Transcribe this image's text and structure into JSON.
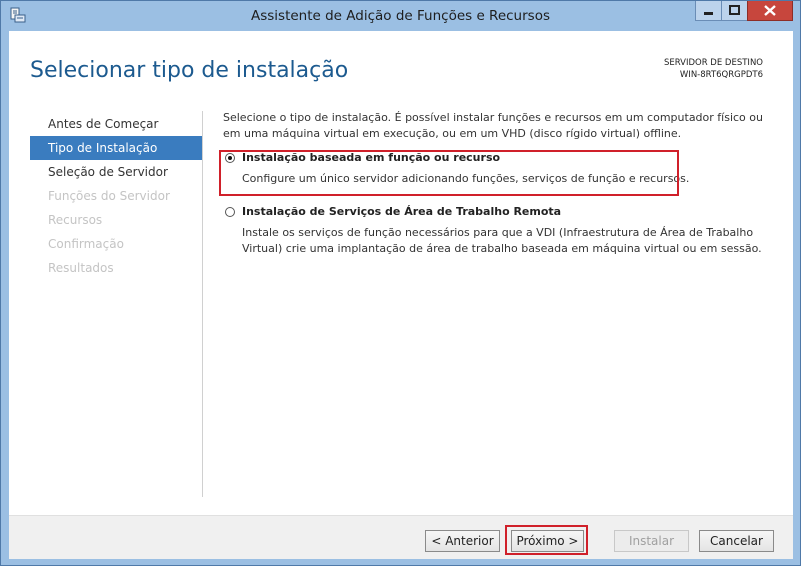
{
  "window": {
    "title": "Assistente de Adição de Funções e Recursos",
    "colors": {
      "frame": "#9bbfe3",
      "accent": "#3a7cbf",
      "title_text": "#1c5a8f",
      "highlight": "#d0202a"
    }
  },
  "header": {
    "page_title": "Selecionar tipo de instalação",
    "dest_label": "SERVIDOR DE DESTINO",
    "dest_name": "WIN-8RT6QRGPDT6"
  },
  "nav": {
    "items": [
      {
        "label": "Antes de Começar",
        "state": "normal"
      },
      {
        "label": "Tipo de Instalação",
        "state": "selected"
      },
      {
        "label": "Seleção de Servidor",
        "state": "normal"
      },
      {
        "label": "Funções do Servidor",
        "state": "disabled"
      },
      {
        "label": "Recursos",
        "state": "disabled"
      },
      {
        "label": "Confirmação",
        "state": "disabled"
      },
      {
        "label": "Resultados",
        "state": "disabled"
      }
    ]
  },
  "content": {
    "intro": "Selecione o tipo de instalação. É possível instalar funções e recursos em um computador físico ou em uma máquina virtual em execução, ou em um VHD (disco rígido virtual) offline.",
    "options": [
      {
        "label": "Instalação baseada em função ou recurso",
        "description": "Configure um único servidor adicionando funções, serviços de função e recursos.",
        "selected": true
      },
      {
        "label": "Instalação de Serviços de Área de Trabalho Remota",
        "description": "Instale os serviços de função necessários para que a VDI (Infraestrutura de Área de Trabalho Virtual) crie uma implantação de área de trabalho baseada em máquina virtual ou em sessão.",
        "selected": false
      }
    ]
  },
  "footer": {
    "prev_label": "< Anterior",
    "next_label": "Próximo >",
    "install_label": "Instalar",
    "cancel_label": "Cancelar"
  }
}
